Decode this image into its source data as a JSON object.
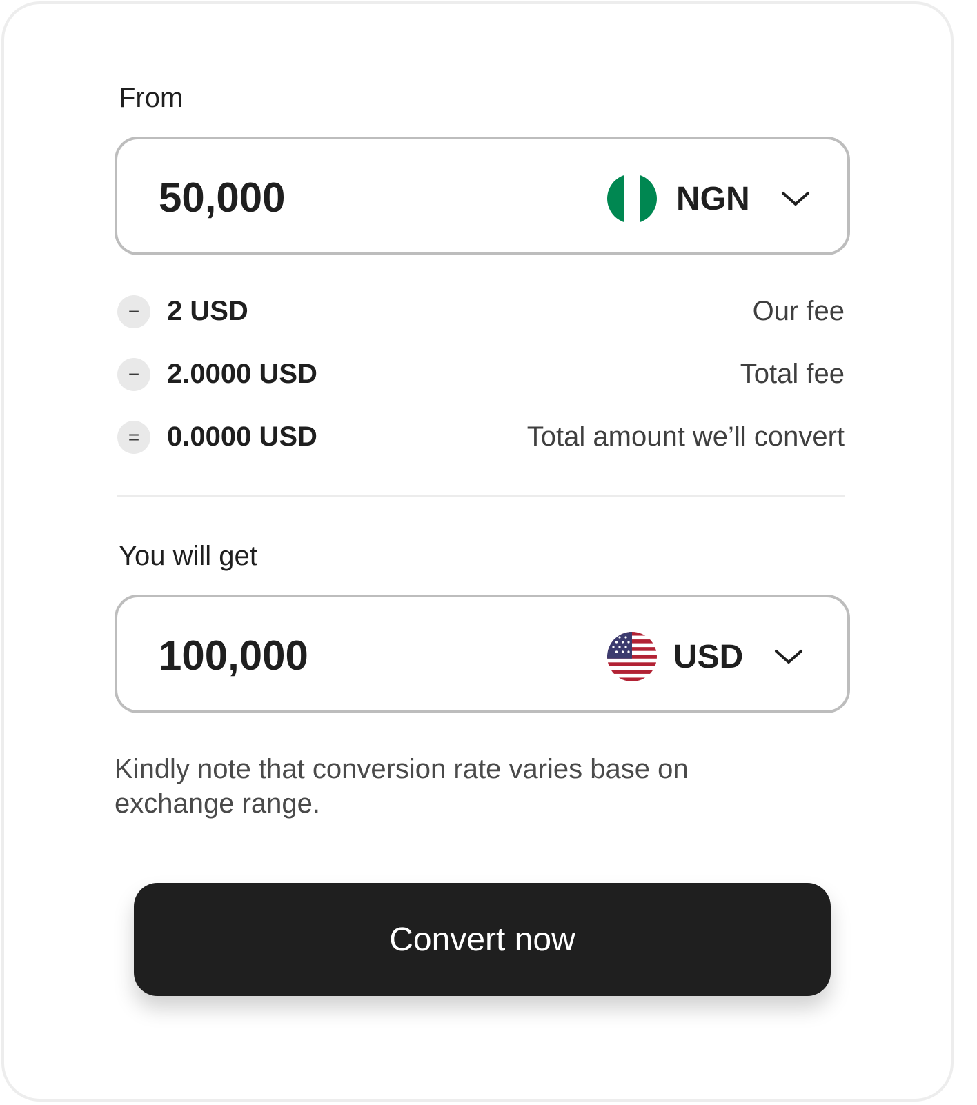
{
  "from": {
    "label": "From",
    "amount": "50,000",
    "currency": "NGN",
    "flag_icon": "nigeria-flag-icon"
  },
  "fees": [
    {
      "operator": "−",
      "value": "2 USD",
      "description": "Our fee"
    },
    {
      "operator": "−",
      "value": "2.0000 USD",
      "description": "Total fee"
    },
    {
      "operator": "=",
      "value": "0.0000 USD",
      "description": "Total amount we’ll convert"
    }
  ],
  "to": {
    "label": "You will get",
    "amount": "100,000",
    "currency": "USD",
    "flag_icon": "usa-flag-icon"
  },
  "note": "Kindly note that conversion rate varies base on exchange range.",
  "action": {
    "convert_label": "Convert now"
  },
  "colors": {
    "button_bg": "#1f1f1f",
    "nigeria_green": "#008751",
    "usa_red": "#b22234",
    "usa_blue": "#3c3b6e"
  }
}
